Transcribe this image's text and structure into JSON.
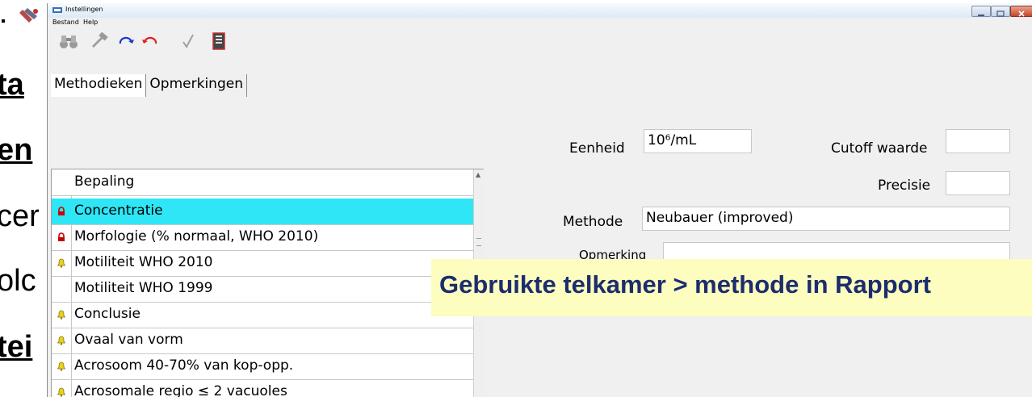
{
  "background": {
    "fragments": [
      "ta",
      "en",
      "cer",
      "olc",
      "tei"
    ],
    "top_icon": "tools-icon"
  },
  "window": {
    "title": "Instellingen",
    "title_icon": "app-icon",
    "controls": [
      "minimize-icon",
      "maximize-icon",
      "close-icon"
    ]
  },
  "menu": {
    "items": [
      "Bestand",
      "Help"
    ]
  },
  "toolbar": {
    "icons": [
      "binoculars-icon",
      "hammer-icon",
      "redo-icon",
      "undo-icon",
      "checkmark-icon",
      "report-icon"
    ]
  },
  "tabs": [
    {
      "label": "Methodieken",
      "active": true
    },
    {
      "label": "Opmerkingen",
      "active": false
    }
  ],
  "grid": {
    "header": "Bepaling",
    "rows": [
      {
        "label": "Concentratie",
        "icon": "lock-red-icon",
        "selected": true
      },
      {
        "label": "Morfologie (% normaal, WHO 2010)",
        "icon": "lock-red-icon",
        "selected": false
      },
      {
        "label": "Motiliteit WHO 2010",
        "icon": "bell-icon",
        "selected": false
      },
      {
        "label": "Motiliteit WHO 1999",
        "icon": "",
        "selected": false
      },
      {
        "label": "Conclusie",
        "icon": "bell-icon",
        "selected": false
      },
      {
        "label": "Ovaal van vorm",
        "icon": "bell-icon",
        "selected": false
      },
      {
        "label": "Acrosoom 40-70% van kop-opp.",
        "icon": "bell-icon",
        "selected": false
      },
      {
        "label": "Acrosomale regio ≤ 2 vacuoles",
        "icon": "bell-icon",
        "selected": false
      }
    ]
  },
  "form": {
    "eenheid_label": "Eenheid",
    "eenheid_value": "10⁶/mL",
    "cutoff_label": "Cutoff waarde",
    "cutoff_value": "",
    "precisie_label": "Precisie",
    "precisie_value": "",
    "methode_label": "Methode",
    "methode_value": "Neubauer (improved)",
    "opmerking_label": "Opmerking",
    "opmerking_value": ""
  },
  "callout": {
    "text": "Gebruikte telkamer > methode in Rapport"
  },
  "colors": {
    "selected_row": "#2ee6f5",
    "callout_bg": "#fdfdbf",
    "callout_text": "#1c2d6e",
    "lock_red": "#cc0000",
    "bell_yellow": "#e8d21a"
  }
}
